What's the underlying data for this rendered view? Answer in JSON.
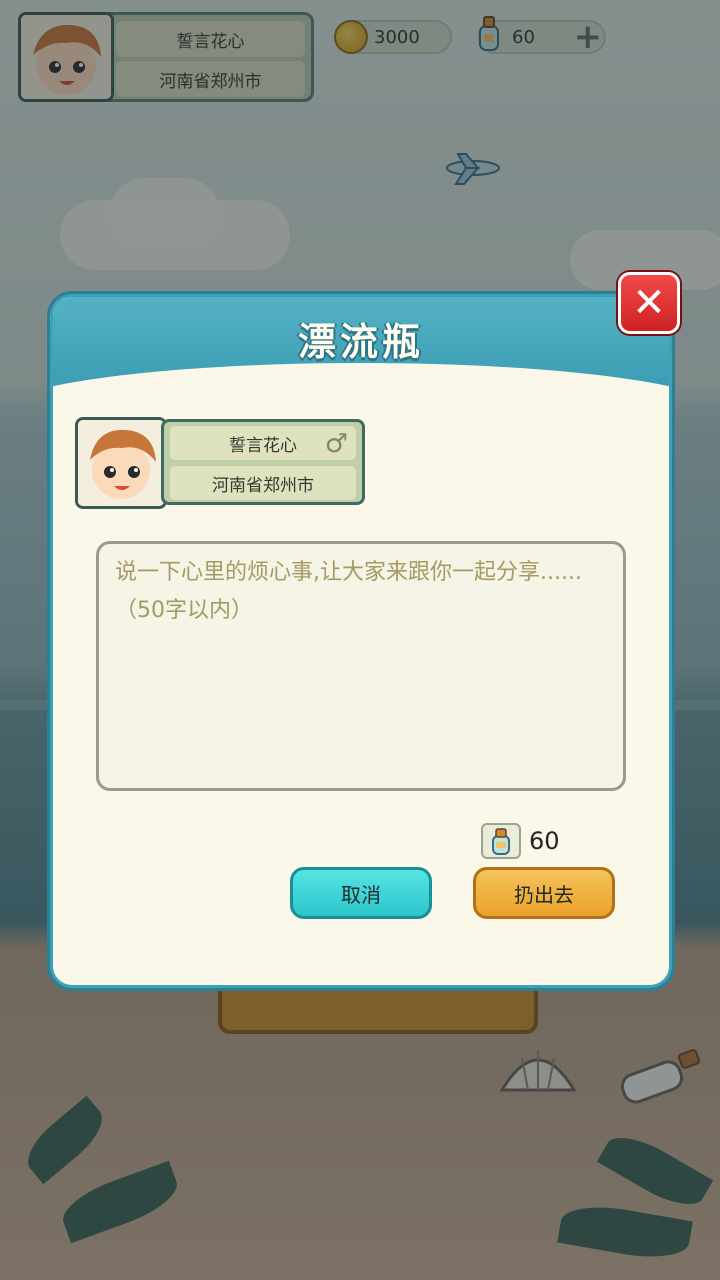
{
  "top_bar": {
    "player_name": "誓言花心",
    "player_location": "河南省郑州市",
    "coins": "3000",
    "bottles": "60"
  },
  "modal": {
    "title": "漂流瓶",
    "user": {
      "name": "誓言花心",
      "gender_symbol": "♂",
      "location": "河南省郑州市"
    },
    "message_placeholder": "说一下心里的烦心事,让大家来跟你一起分享......（50字以内）",
    "bottle_cost": "60",
    "cancel_label": "取消",
    "throw_label": "扔出去"
  },
  "colors": {
    "modal_border": "#3da1b7",
    "cancel_button": "#2bc6cc",
    "throw_button": "#eaa22a",
    "close_button": "#cf2222"
  },
  "icons": {
    "close": "close-icon",
    "coin": "coin-icon",
    "bottle": "bottle-icon",
    "plus": "plus-icon",
    "gender": "male-icon"
  }
}
